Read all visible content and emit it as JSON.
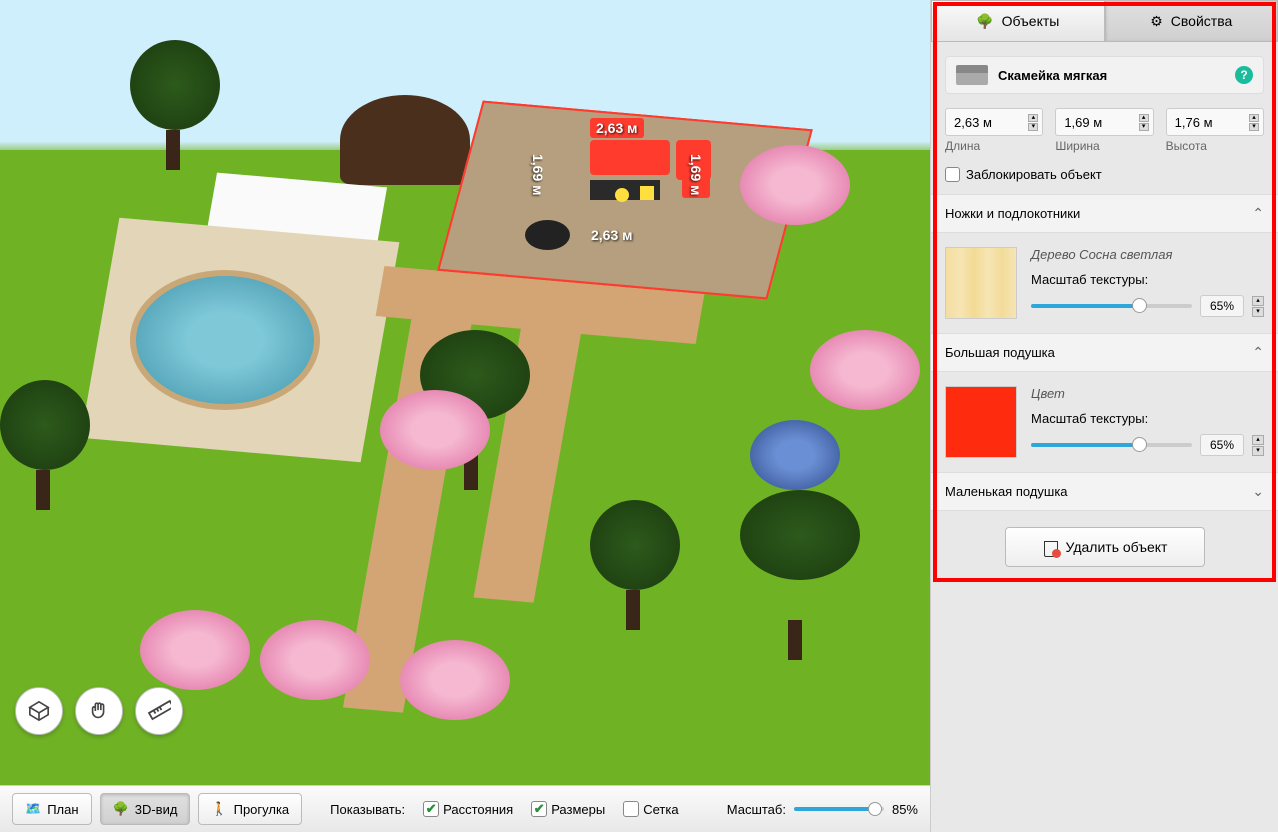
{
  "viewport": {
    "dimensions": {
      "top": "2,63 м",
      "bottom": "2,63 м",
      "left": "1,69 м",
      "right": "1,69 м"
    }
  },
  "tools": {
    "rotate": "⬚",
    "pan": "✋",
    "measure": "📏"
  },
  "bottom_bar": {
    "views": {
      "plan": "План",
      "view3d": "3D-вид",
      "walk": "Прогулка"
    },
    "show_label": "Показывать:",
    "checks": {
      "distances": "Расстояния",
      "sizes": "Размеры",
      "grid": "Сетка"
    },
    "scale_label": "Масштаб:",
    "scale_value": "85%"
  },
  "panel": {
    "tabs": {
      "objects": "Объекты",
      "properties": "Свойства"
    },
    "object_name": "Скамейка мягкая",
    "dims": {
      "length": {
        "value": "2,63",
        "unit": "м",
        "label": "Длина"
      },
      "width": {
        "value": "1,69",
        "unit": "м",
        "label": "Ширина"
      },
      "height": {
        "value": "1,76",
        "unit": "м",
        "label": "Высота"
      }
    },
    "lock_label": "Заблокировать объект",
    "sections": {
      "legs": {
        "title": "Ножки и подлокотники",
        "material": "Дерево Сосна светлая",
        "scale_label": "Масштаб текстуры:",
        "scale_value": "65%"
      },
      "big_pillow": {
        "title": "Большая подушка",
        "material": "Цвет",
        "scale_label": "Масштаб текстуры:",
        "scale_value": "65%"
      },
      "small_pillow": {
        "title": "Маленькая подушка"
      }
    },
    "delete_label": "Удалить объект"
  }
}
